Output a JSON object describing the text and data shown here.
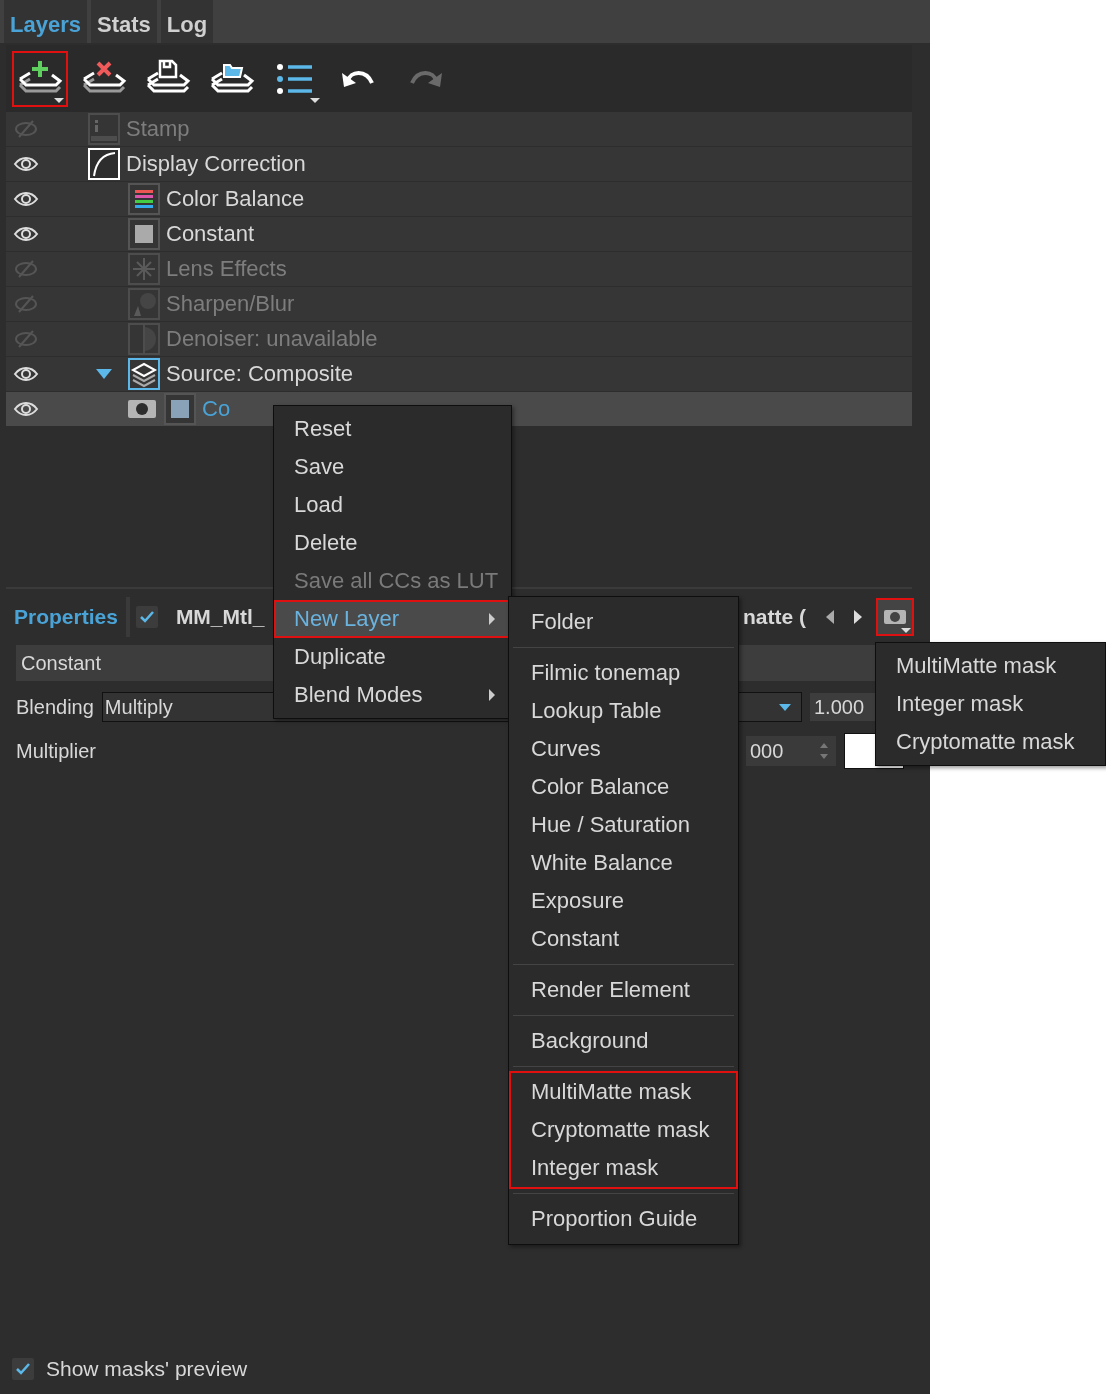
{
  "tabs": [
    {
      "label": "Layers",
      "selected": true
    },
    {
      "label": "Stats",
      "selected": false
    },
    {
      "label": "Log",
      "selected": false
    }
  ],
  "toolbar": [
    {
      "kind": "add",
      "outlined": true,
      "dropdown": true,
      "disabled": false
    },
    {
      "kind": "remove",
      "outlined": false,
      "dropdown": false,
      "disabled": false
    },
    {
      "kind": "save",
      "outlined": false,
      "dropdown": false,
      "disabled": false
    },
    {
      "kind": "open",
      "outlined": false,
      "dropdown": false,
      "disabled": false
    },
    {
      "kind": "list",
      "outlined": false,
      "dropdown": true,
      "disabled": false
    },
    {
      "kind": "undo",
      "outlined": false,
      "dropdown": false,
      "disabled": false
    },
    {
      "kind": "redo",
      "outlined": false,
      "dropdown": false,
      "disabled": true
    }
  ],
  "layers": [
    {
      "name": "Stamp",
      "kind": "stamp",
      "visible": false,
      "selected": false,
      "masked": false
    },
    {
      "name": "Display Correction",
      "kind": "curve",
      "visible": true,
      "selected": false,
      "masked": false,
      "children": [
        {
          "name": "Color Balance",
          "kind": "balance",
          "visible": true,
          "selected": false,
          "masked": false
        },
        {
          "name": "Constant",
          "kind": "constant",
          "visible": true,
          "selected": false,
          "masked": false
        },
        {
          "name": "Lens Effects",
          "kind": "lens",
          "visible": false,
          "selected": false,
          "masked": false
        },
        {
          "name": "Sharpen/Blur",
          "kind": "sharpen",
          "visible": false,
          "selected": false,
          "masked": false
        },
        {
          "name": "Denoiser: unavailable",
          "kind": "denoise",
          "visible": false,
          "selected": false,
          "masked": false
        },
        {
          "name": "Source: Composite",
          "kind": "composite",
          "visible": true,
          "selected": false,
          "masked": false,
          "expanded": true,
          "children": [
            {
              "name": "Co",
              "kind": "constant",
              "visible": true,
              "selected": true,
              "masked": true
            }
          ]
        }
      ]
    }
  ],
  "properties": {
    "tab": "Properties",
    "enabled": true,
    "title_start": "MM_Mtl_",
    "title_end": "natte (",
    "mask_outlined": true,
    "layer_type": "Constant",
    "blending_label": "Blending",
    "blending_value": "Multiply",
    "opacity": "1.000",
    "multiplier_label": "Multiplier",
    "multiplier_value": "000"
  },
  "footer": {
    "label": "Show masks' preview",
    "checked": true
  },
  "context_menu": [
    {
      "label": "Reset",
      "kind": "item",
      "disabled": false,
      "selected": false,
      "outlined": false
    },
    {
      "label": "Save",
      "kind": "item",
      "disabled": false,
      "selected": false,
      "outlined": false
    },
    {
      "label": "Load",
      "kind": "item",
      "disabled": false,
      "selected": false,
      "outlined": false
    },
    {
      "label": "Delete",
      "kind": "item",
      "disabled": false,
      "selected": false,
      "outlined": false
    },
    {
      "label": "Save all CCs as LUT",
      "kind": "item",
      "disabled": true,
      "selected": false,
      "outlined": false
    },
    {
      "label": "New Layer",
      "kind": "submenu",
      "disabled": false,
      "selected": true,
      "outlined": true
    },
    {
      "label": "Duplicate",
      "kind": "item",
      "disabled": false,
      "selected": false,
      "outlined": false
    },
    {
      "label": "Blend Modes",
      "kind": "submenu",
      "disabled": false,
      "selected": false,
      "outlined": false
    }
  ],
  "new_layer_menu": [
    {
      "outlined": false,
      "items": [
        "Folder"
      ]
    },
    {
      "outlined": false,
      "items": [
        "Filmic tonemap",
        "Lookup Table",
        "Curves",
        "Color Balance",
        "Hue / Saturation",
        "White Balance",
        "Exposure",
        "Constant"
      ]
    },
    {
      "outlined": false,
      "items": [
        "Render Element"
      ]
    },
    {
      "outlined": false,
      "items": [
        "Background"
      ]
    },
    {
      "outlined": true,
      "items": [
        "MultiMatte mask",
        "Cryptomatte mask",
        "Integer mask"
      ]
    },
    {
      "outlined": false,
      "items": [
        "Proportion Guide"
      ]
    }
  ],
  "mask_menu": [
    "MultiMatte mask",
    "Integer mask",
    "Cryptomatte mask"
  ]
}
